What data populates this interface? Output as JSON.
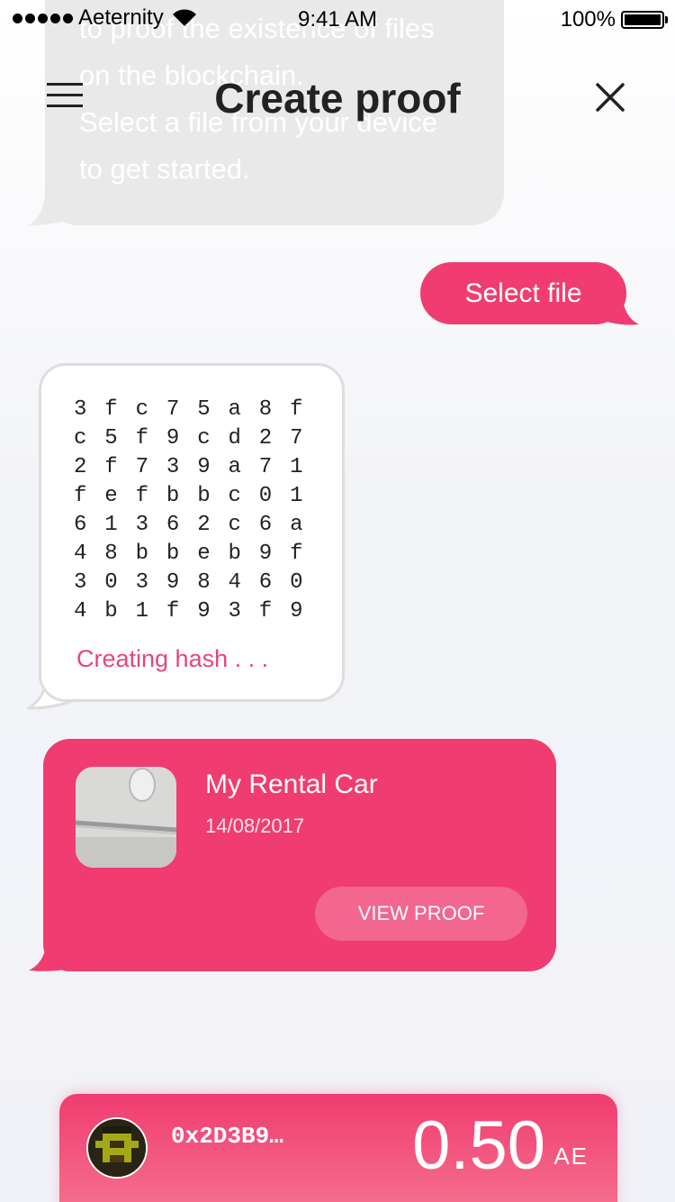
{
  "status_bar": {
    "carrier": "Aeternity",
    "time": "9:41 AM",
    "battery_percent": "100%"
  },
  "header": {
    "title": "Create proof",
    "menu_icon": "hamburger-menu-icon",
    "close_icon": "close-icon"
  },
  "intro_bubble": {
    "lines": [
      "to proof the existence of files",
      "on the blockchain.",
      "Select a file from your device",
      "to get started."
    ]
  },
  "select_file": {
    "label": "Select file"
  },
  "hash_bubble": {
    "rows": [
      "3fc75a8f",
      "c5f9cd27",
      "2f739a71",
      "fefbbc01",
      "61362c6a",
      "48bbeb9f",
      "30398460",
      "4b1f93f9"
    ],
    "status": "Creating hash . . ."
  },
  "proof_card": {
    "title": "My Rental Car",
    "date": "14/08/2017",
    "button_label": "VIEW PROOF"
  },
  "wallet": {
    "address": "0x2D3B9…",
    "balance": "0.50",
    "unit": "AE"
  },
  "colors": {
    "accent": "#f03c70",
    "bubble_grey": "#e9e9e9",
    "hash_text_accent": "#e8457a"
  }
}
